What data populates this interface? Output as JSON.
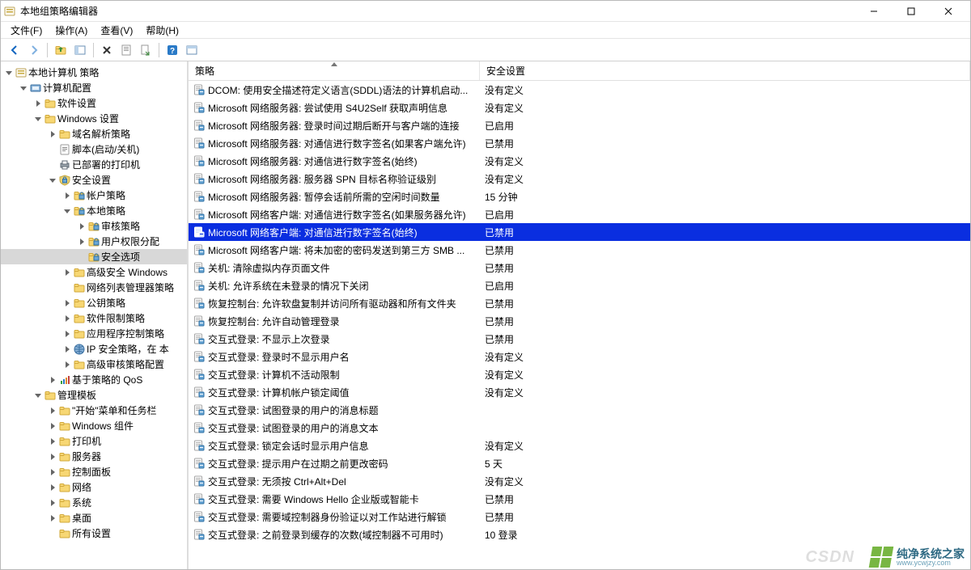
{
  "window": {
    "title": "本地组策略编辑器"
  },
  "menu": {
    "file": "文件(F)",
    "action": "操作(A)",
    "view": "查看(V)",
    "help": "帮助(H)"
  },
  "tree": [
    {
      "depth": 0,
      "ex": "open",
      "ico": "mmc",
      "label": "本地计算机 策略"
    },
    {
      "depth": 1,
      "ex": "open",
      "ico": "config",
      "label": "计算机配置"
    },
    {
      "depth": 2,
      "ex": "closed",
      "ico": "folder",
      "label": "软件设置"
    },
    {
      "depth": 2,
      "ex": "open",
      "ico": "folder",
      "label": "Windows 设置"
    },
    {
      "depth": 3,
      "ex": "closed",
      "ico": "folder",
      "label": "域名解析策略"
    },
    {
      "depth": 3,
      "ex": "none",
      "ico": "script",
      "label": "脚本(启动/关机)"
    },
    {
      "depth": 3,
      "ex": "none",
      "ico": "printer",
      "label": "已部署的打印机"
    },
    {
      "depth": 3,
      "ex": "open",
      "ico": "sec",
      "label": "安全设置"
    },
    {
      "depth": 4,
      "ex": "closed",
      "ico": "fsec",
      "label": "帐户策略"
    },
    {
      "depth": 4,
      "ex": "open",
      "ico": "fsec",
      "label": "本地策略"
    },
    {
      "depth": 5,
      "ex": "closed",
      "ico": "fsec",
      "label": "审核策略"
    },
    {
      "depth": 5,
      "ex": "closed",
      "ico": "fsec",
      "label": "用户权限分配"
    },
    {
      "depth": 5,
      "ex": "none",
      "ico": "fsec",
      "label": "安全选项",
      "selected": true
    },
    {
      "depth": 4,
      "ex": "closed",
      "ico": "folder",
      "label": "高级安全 Windows"
    },
    {
      "depth": 4,
      "ex": "none",
      "ico": "folder",
      "label": "网络列表管理器策略"
    },
    {
      "depth": 4,
      "ex": "closed",
      "ico": "folder",
      "label": "公钥策略"
    },
    {
      "depth": 4,
      "ex": "closed",
      "ico": "folder",
      "label": "软件限制策略"
    },
    {
      "depth": 4,
      "ex": "closed",
      "ico": "folder",
      "label": "应用程序控制策略"
    },
    {
      "depth": 4,
      "ex": "closed",
      "ico": "ipsec",
      "label": "IP 安全策略，在 本"
    },
    {
      "depth": 4,
      "ex": "closed",
      "ico": "folder",
      "label": "高级审核策略配置"
    },
    {
      "depth": 3,
      "ex": "closed",
      "ico": "qos",
      "label": "基于策略的 QoS"
    },
    {
      "depth": 2,
      "ex": "open",
      "ico": "folder",
      "label": "管理模板"
    },
    {
      "depth": 3,
      "ex": "closed",
      "ico": "folder",
      "label": "\"开始\"菜单和任务栏"
    },
    {
      "depth": 3,
      "ex": "closed",
      "ico": "folder",
      "label": "Windows 组件"
    },
    {
      "depth": 3,
      "ex": "closed",
      "ico": "folder",
      "label": "打印机"
    },
    {
      "depth": 3,
      "ex": "closed",
      "ico": "folder",
      "label": "服务器"
    },
    {
      "depth": 3,
      "ex": "closed",
      "ico": "folder",
      "label": "控制面板"
    },
    {
      "depth": 3,
      "ex": "closed",
      "ico": "folder",
      "label": "网络"
    },
    {
      "depth": 3,
      "ex": "closed",
      "ico": "folder",
      "label": "系统"
    },
    {
      "depth": 3,
      "ex": "closed",
      "ico": "folder",
      "label": "桌面"
    },
    {
      "depth": 3,
      "ex": "none",
      "ico": "folder",
      "label": "所有设置"
    }
  ],
  "columns": {
    "policy": "策略",
    "setting": "安全设置"
  },
  "rows": [
    {
      "name": "DCOM: 使用安全描述符定义语言(SDDL)语法的计算机启动...",
      "value": "没有定义"
    },
    {
      "name": "Microsoft 网络服务器: 尝试使用 S4U2Self 获取声明信息",
      "value": "没有定义"
    },
    {
      "name": "Microsoft 网络服务器: 登录时间过期后断开与客户端的连接",
      "value": "已启用"
    },
    {
      "name": "Microsoft 网络服务器: 对通信进行数字签名(如果客户端允许)",
      "value": "已禁用"
    },
    {
      "name": "Microsoft 网络服务器: 对通信进行数字签名(始终)",
      "value": "没有定义"
    },
    {
      "name": "Microsoft 网络服务器: 服务器 SPN 目标名称验证级别",
      "value": "没有定义"
    },
    {
      "name": "Microsoft 网络服务器: 暂停会话前所需的空闲时间数量",
      "value": "15 分钟"
    },
    {
      "name": "Microsoft 网络客户端: 对通信进行数字签名(如果服务器允许)",
      "value": "已启用"
    },
    {
      "name": "Microsoft 网络客户端: 对通信进行数字签名(始终)",
      "value": "已禁用",
      "selected": true
    },
    {
      "name": "Microsoft 网络客户端: 将未加密的密码发送到第三方 SMB ...",
      "value": "已禁用"
    },
    {
      "name": "关机: 清除虚拟内存页面文件",
      "value": "已禁用"
    },
    {
      "name": "关机: 允许系统在未登录的情况下关闭",
      "value": "已启用"
    },
    {
      "name": "恢复控制台: 允许软盘复制并访问所有驱动器和所有文件夹",
      "value": "已禁用"
    },
    {
      "name": "恢复控制台: 允许自动管理登录",
      "value": "已禁用"
    },
    {
      "name": "交互式登录: 不显示上次登录",
      "value": "已禁用"
    },
    {
      "name": "交互式登录: 登录时不显示用户名",
      "value": "没有定义"
    },
    {
      "name": "交互式登录: 计算机不活动限制",
      "value": "没有定义"
    },
    {
      "name": "交互式登录: 计算机帐户锁定阈值",
      "value": "没有定义"
    },
    {
      "name": "交互式登录: 试图登录的用户的消息标题",
      "value": ""
    },
    {
      "name": "交互式登录: 试图登录的用户的消息文本",
      "value": ""
    },
    {
      "name": "交互式登录: 锁定会话时显示用户信息",
      "value": "没有定义"
    },
    {
      "name": "交互式登录: 提示用户在过期之前更改密码",
      "value": "5 天"
    },
    {
      "name": "交互式登录: 无须按 Ctrl+Alt+Del",
      "value": "没有定义"
    },
    {
      "name": "交互式登录: 需要 Windows Hello 企业版或智能卡",
      "value": "已禁用"
    },
    {
      "name": "交互式登录: 需要域控制器身份验证以对工作站进行解锁",
      "value": "已禁用"
    },
    {
      "name": "交互式登录: 之前登录到缓存的次数(域控制器不可用时)",
      "value": "10 登录"
    }
  ],
  "watermark": {
    "csdn": "CSDN",
    "zh": "纯净系统之家",
    "en": "www.ycwjzy.com"
  }
}
